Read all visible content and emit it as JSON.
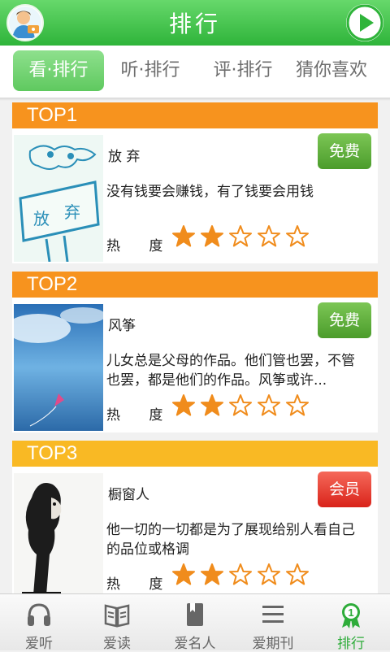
{
  "header": {
    "title": "排行"
  },
  "tabs": [
    {
      "label": "看·排行",
      "active": true
    },
    {
      "label": "听·排行",
      "active": false
    },
    {
      "label": "评·排行",
      "active": false
    },
    {
      "label": "猜你喜欢",
      "active": false
    }
  ],
  "items": [
    {
      "rank": "TOP1",
      "title": "放 弃",
      "badge": "免费",
      "badge_type": "free",
      "desc": "没有钱要会赚钱，有了钱要会用钱",
      "heat_label": "热 度",
      "rating": 2,
      "rating_max": 5
    },
    {
      "rank": "TOP2",
      "title": "风筝",
      "badge": "免费",
      "badge_type": "free",
      "desc": "儿女总是父母的作品。他们管也罢，不管也罢，都是他们的作品。风筝或许...",
      "heat_label": "热 度",
      "rating": 2,
      "rating_max": 5
    },
    {
      "rank": "TOP3",
      "title": "橱窗人",
      "badge": "会员",
      "badge_type": "vip",
      "desc": "他一切的一切都是为了展现给别人看自己的品位或格调",
      "heat_label": "热 度",
      "rating": 2,
      "rating_max": 5
    }
  ],
  "bottom_nav": [
    {
      "label": "爱听",
      "icon": "headphones-icon",
      "active": false
    },
    {
      "label": "爱读",
      "icon": "open-book-icon",
      "active": false
    },
    {
      "label": "爱名人",
      "icon": "book-icon",
      "active": false
    },
    {
      "label": "爱期刊",
      "icon": "list-icon",
      "active": false
    },
    {
      "label": "排行",
      "icon": "ranking-medal-icon",
      "active": true
    }
  ],
  "colors": {
    "green": "#2fb43a",
    "orange": "#f7931e",
    "yellow": "#f9b924",
    "star": "#f08c1c"
  }
}
